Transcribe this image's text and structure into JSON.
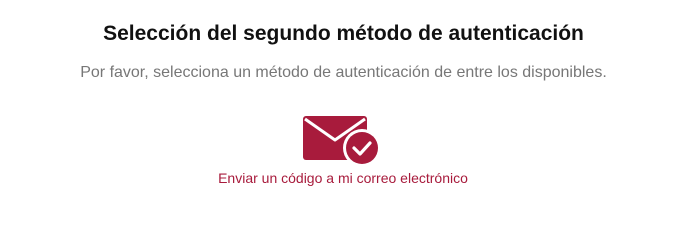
{
  "header": {
    "title": "Selección del segundo método de autenticación",
    "subtitle": "Por favor, selecciona un método de autenticación de entre los disponibles."
  },
  "methods": [
    {
      "icon": "envelope-check-icon",
      "label": "Enviar un código a mi correo electrónico"
    }
  ],
  "colors": {
    "accent": "#a81b3c",
    "title": "#111111",
    "subtitle": "#777777"
  }
}
